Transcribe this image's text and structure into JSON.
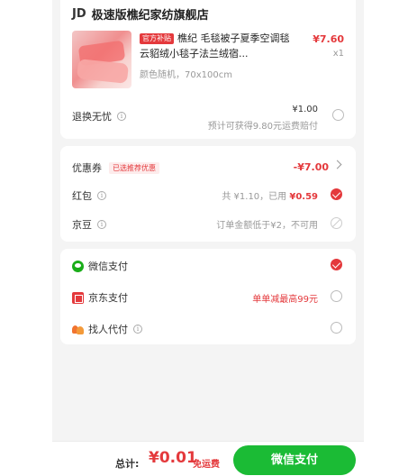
{
  "shop": {
    "logo": "JD",
    "name": "极速版樵纪家纺旗舰店"
  },
  "product": {
    "tag": "官方补贴",
    "title": "樵纪 毛毯被子夏季空调毯云貂绒小毯子法兰绒宿...",
    "spec": "颜色随机，70x100cm",
    "price": "¥7.60",
    "qty": "x1"
  },
  "refund": {
    "label": "退换无忧",
    "price": "¥1.00",
    "note": "预计可获得9.80元运费赔付"
  },
  "coupon": {
    "label": "优惠券",
    "tag": "已选推荐优惠",
    "value": "-¥7.00"
  },
  "hongbao": {
    "label": "红包",
    "prefix": "共 ¥1.10，已用",
    "used": "¥0.59"
  },
  "jingdou": {
    "label": "京豆",
    "note": "订单金额低于¥2，不可用"
  },
  "payment": {
    "options": [
      {
        "label": "微信支付",
        "icon": "wechat-icon",
        "note": "",
        "selected": true
      },
      {
        "label": "京东支付",
        "icon": "jd-pay-icon",
        "note": "单单减最高99元",
        "selected": false
      },
      {
        "label": "找人代付",
        "icon": "friends-icon",
        "note": "",
        "selected": false
      }
    ]
  },
  "footer": {
    "total_label": "总计:",
    "total_amount": "¥0.01",
    "shipping": "免运费",
    "pay_button": "微信支付"
  },
  "colors": {
    "accent": "#e4393c",
    "pay_green": "#1bbb35"
  }
}
